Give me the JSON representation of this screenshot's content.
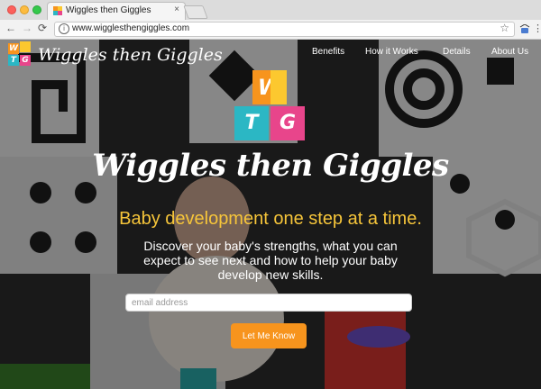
{
  "browser": {
    "tab_title": "Wiggles then Giggles",
    "tab_close": "×",
    "url": "www.wigglesthengiggles.com",
    "back_icon": "←",
    "forward_icon": "→",
    "reload_icon": "⟳",
    "info_icon": "i",
    "star_icon": "☆",
    "menu_icon": "⋮"
  },
  "site": {
    "brand": "Wiggles then Giggles",
    "logo_letters": [
      "W",
      "T",
      "G"
    ],
    "nav": [
      "Benefits",
      "How it Works",
      "Details",
      "About Us"
    ],
    "headline": "Wiggles then Giggles",
    "tagline": "Baby development one step at a time.",
    "description": "Discover your baby's strengths, what you can expect to see next and how to help your baby develop new skills.",
    "email_placeholder": "email address",
    "cta_label": "Let Me Know"
  },
  "colors": {
    "logo_orange": "#f7941d",
    "logo_yellow": "#fcc82f",
    "logo_teal": "#2bb7c4",
    "logo_pink": "#e8458b",
    "tagline": "#f6c53a",
    "cta": "#f7941d"
  }
}
